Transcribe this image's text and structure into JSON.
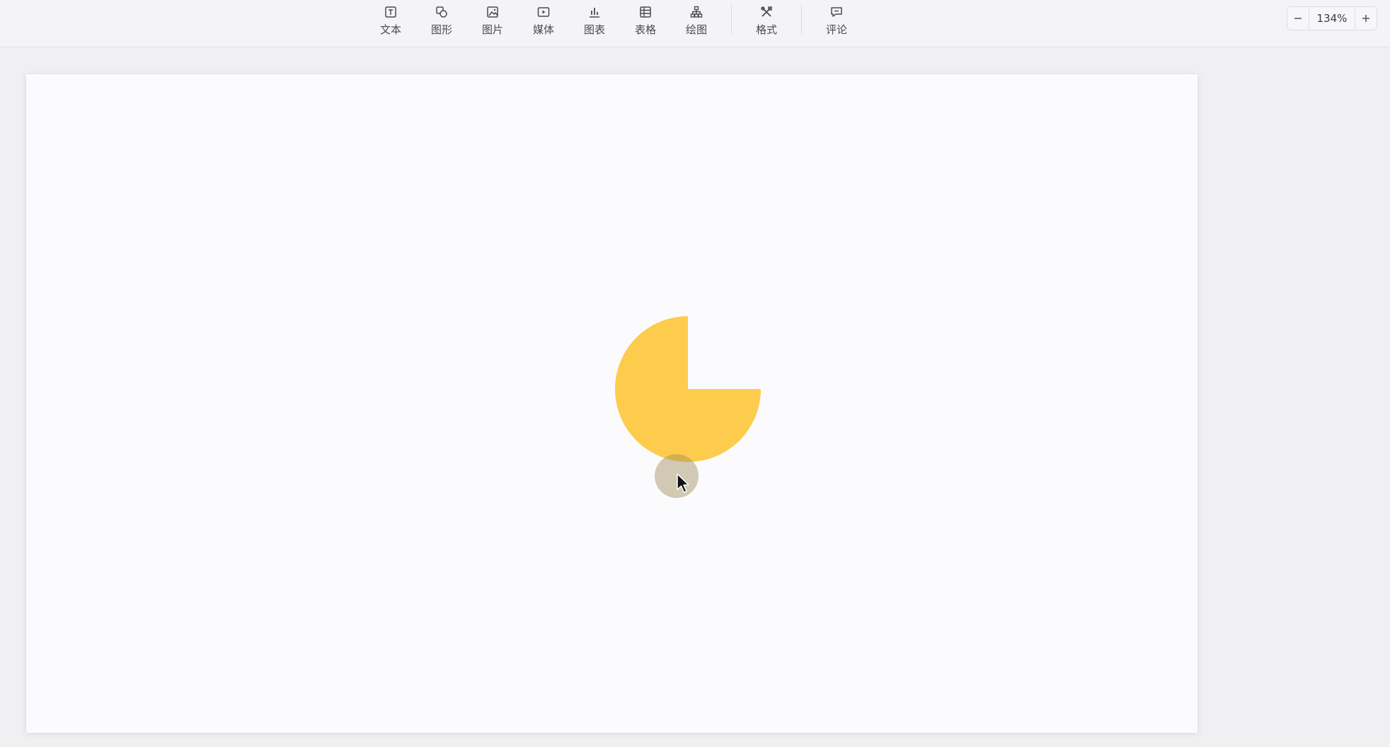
{
  "toolbar": {
    "items": [
      {
        "label": "文本",
        "icon": "text-box-icon"
      },
      {
        "label": "图形",
        "icon": "shape-icon"
      },
      {
        "label": "图片",
        "icon": "image-icon"
      },
      {
        "label": "媒体",
        "icon": "media-play-icon"
      },
      {
        "label": "图表",
        "icon": "bar-chart-icon"
      },
      {
        "label": "表格",
        "icon": "table-icon"
      },
      {
        "label": "绘图",
        "icon": "diagram-icon"
      },
      {
        "label": "格式",
        "icon": "format-tools-icon"
      },
      {
        "label": "评论",
        "icon": "comment-icon"
      }
    ]
  },
  "zoom": {
    "value": "134%",
    "decrease_icon": "minus-icon",
    "increase_icon": "plus-icon"
  },
  "canvas": {
    "shape": {
      "type": "pie-three-quarter",
      "fill": "#fdcc4d"
    },
    "cursor_icon": "pointer-arrow-icon"
  }
}
